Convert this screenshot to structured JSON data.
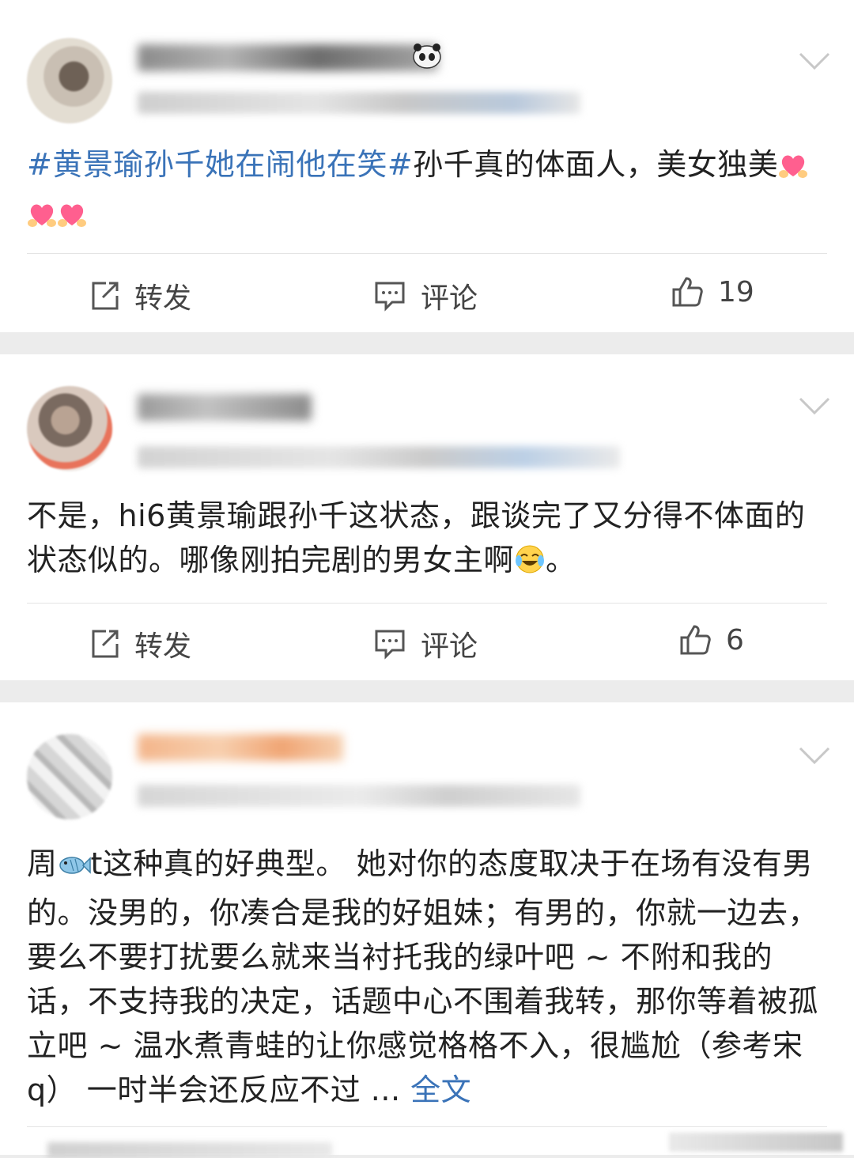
{
  "posts": [
    {
      "topic": "#黄景瑜孙千她在闹他在笑#",
      "text_after_topic": "孙千真的体面人，美女独美",
      "emojis": [
        "heart-hands-emoji",
        "heart-hands-emoji",
        "heart-hands-emoji"
      ],
      "actions": {
        "repost": "转发",
        "comment": "评论",
        "like_count": "19"
      }
    },
    {
      "text": "不是，hi6黄景瑜跟孙千这状态，跟谈完了又分得不体面的状态似的。哪像刚拍完剧的男女主啊",
      "emoji": "laugh-cry-emoji",
      "text_end": "。",
      "actions": {
        "repost": "转发",
        "comment": "评论",
        "like_count": "6"
      }
    },
    {
      "text_before_emoji": "周",
      "emoji": "fish-emoji",
      "text": "t这种真的好典型。 她对你的态度取决于在场有没有男的。没男的，你凑合是我的好姐妹；有男的，你就一边去，要么不要打扰要么就来当衬托我的绿叶吧 ~ 不附和我的话，不支持我的决定，话题中心不围着我转，那你等着被孤立吧 ~ 温水煮青蛙的让你感觉格格不入，很尴尬（参考宋q） 一时半会还反应不过 ...",
      "more": "全文"
    }
  ]
}
